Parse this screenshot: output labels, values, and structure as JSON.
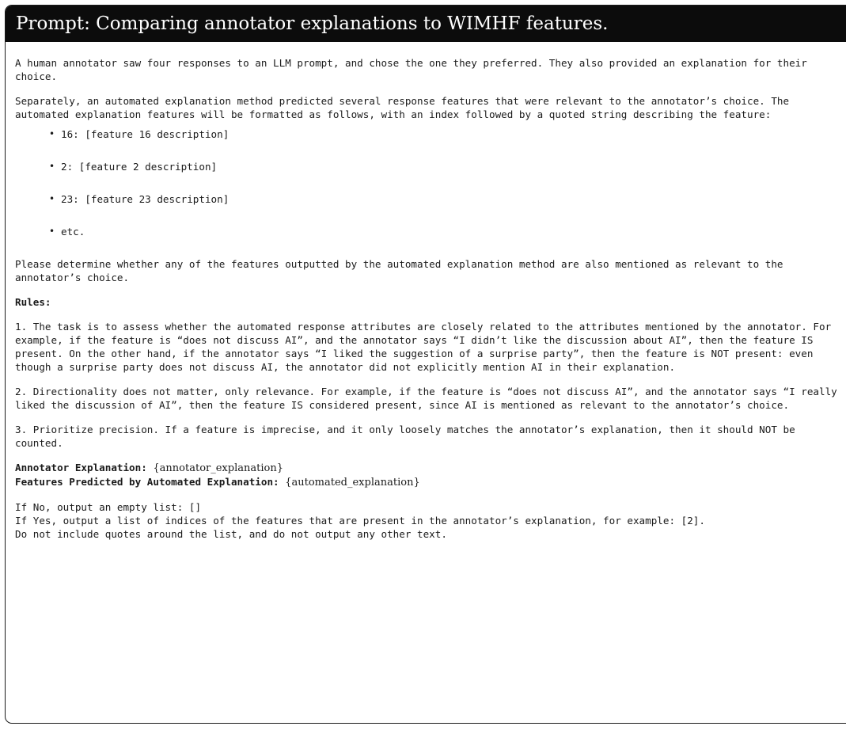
{
  "header": {
    "title": "Prompt: Comparing annotator explanations to WIMHF features."
  },
  "intro": {
    "p1": "A human annotator saw four responses to an LLM prompt, and chose the one they preferred. They also provided an explanation for their choice.",
    "p2": "Separately, an automated explanation method predicted several response features that were relevant to the annotator’s choice. The automated explanation features will be formatted as follows, with an index followed by a quoted string describing the feature:"
  },
  "feature_examples": [
    "16: [feature 16 description]",
    "2: [feature 2 description]",
    "23: [feature 23 description]",
    "etc."
  ],
  "question": "Please determine whether any of the features outputted by the automated explanation method are also mentioned as relevant to the annotator’s choice.",
  "rules": {
    "heading": "Rules:",
    "items": [
      "1. The task is to assess whether the automated response attributes are closely related to the attributes mentioned by the annotator. For example, if the feature is “does not discuss AI”, and the annotator says “I didn’t like the discussion about AI”, then the feature IS present. On the other hand, if the annotator says “I liked the suggestion of a surprise party”, then the feature is NOT present: even though a surprise party does not discuss AI, the annotator did not explicitly mention AI in their explanation.",
      "2. Directionality does not matter, only relevance. For example, if the feature is “does not discuss AI”, and the annotator says “I really liked the discussion of AI”, then the feature IS considered present, since AI is mentioned as relevant to the annotator’s choice.",
      "3. Prioritize precision. If a feature is imprecise, and it only loosely matches the annotator’s explanation, then it should NOT be counted."
    ]
  },
  "fields": {
    "annotator_label": "Annotator Explanation:",
    "annotator_value": "{annotator_explanation}",
    "features_label": "Features Predicted by Automated Explanation:",
    "features_value": "{automated_explanation}"
  },
  "output_instructions": {
    "line1": "If No, output an empty list: []",
    "line2": "If Yes, output a list of indices of the features that are present in the annotator’s explanation, for example: [2].",
    "line3": "Do not include quotes around the list, and do not output any other text."
  }
}
